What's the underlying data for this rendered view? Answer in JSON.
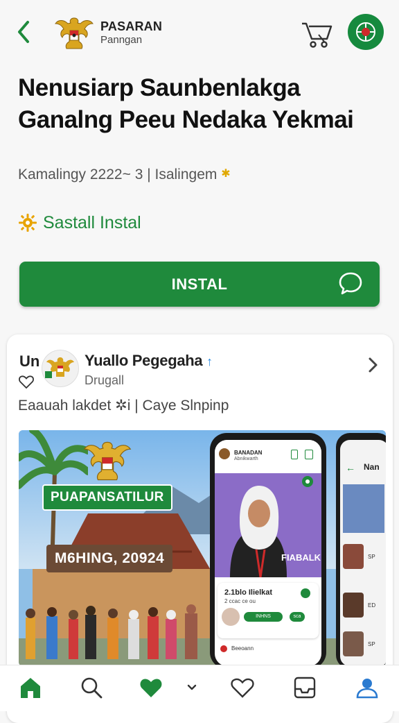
{
  "header": {
    "back_icon": "chevron-left-icon",
    "brand_main": "PASARAN",
    "brand_sub": "Panngan",
    "cart_icon": "cart-icon",
    "profile_icon": "emblem-badge-icon"
  },
  "app": {
    "title": "Nenusiarp Saunbenlakga Ganalng Peeu Nedaka Yekmai",
    "meta": "Kamalingy 2222~ 3 | Isalingem",
    "status": "Sastall Instal",
    "install_label": "INSTAL"
  },
  "card": {
    "prefix": "Un",
    "username": "Yuallo Pegegaha",
    "verified_mark": "↑",
    "subtitle": "Drugall",
    "line": "Eaauah lakdet ✲i | Caye Slnpinp",
    "banner": {
      "tag_green": "PUAPANSATILUR",
      "tag_brown": "M6HING, 20924",
      "phone1": {
        "app_name": "BANADAN",
        "app_sub": "Abnikwarth",
        "hero_caption": "FIABALK",
        "info_title": "2.1blo Ilielkat",
        "info_sub": "2 ccac ce ou",
        "pill_1": "INHNS",
        "pill_2": "sca",
        "footer_text": "Beeoann"
      },
      "phone2": {
        "label": "Nan",
        "row_1": "SP",
        "row_2": "ED",
        "row_3": "SP"
      }
    }
  },
  "bottom_nav": {
    "items": [
      {
        "icon": "home-icon",
        "active": true
      },
      {
        "icon": "search-icon",
        "active": false
      },
      {
        "icon": "heart-filled-icon",
        "active": true
      },
      {
        "icon": "chevron-down-icon",
        "active": false
      },
      {
        "icon": "heart-outline-icon",
        "active": false
      },
      {
        "icon": "inbox-icon",
        "active": false
      },
      {
        "icon": "profile-icon",
        "active": false
      }
    ]
  },
  "colors": {
    "brand_green": "#1f8a3c",
    "background": "#f7f7f7",
    "text_dark": "#111111",
    "banner_purple": "#8b6cc7"
  }
}
